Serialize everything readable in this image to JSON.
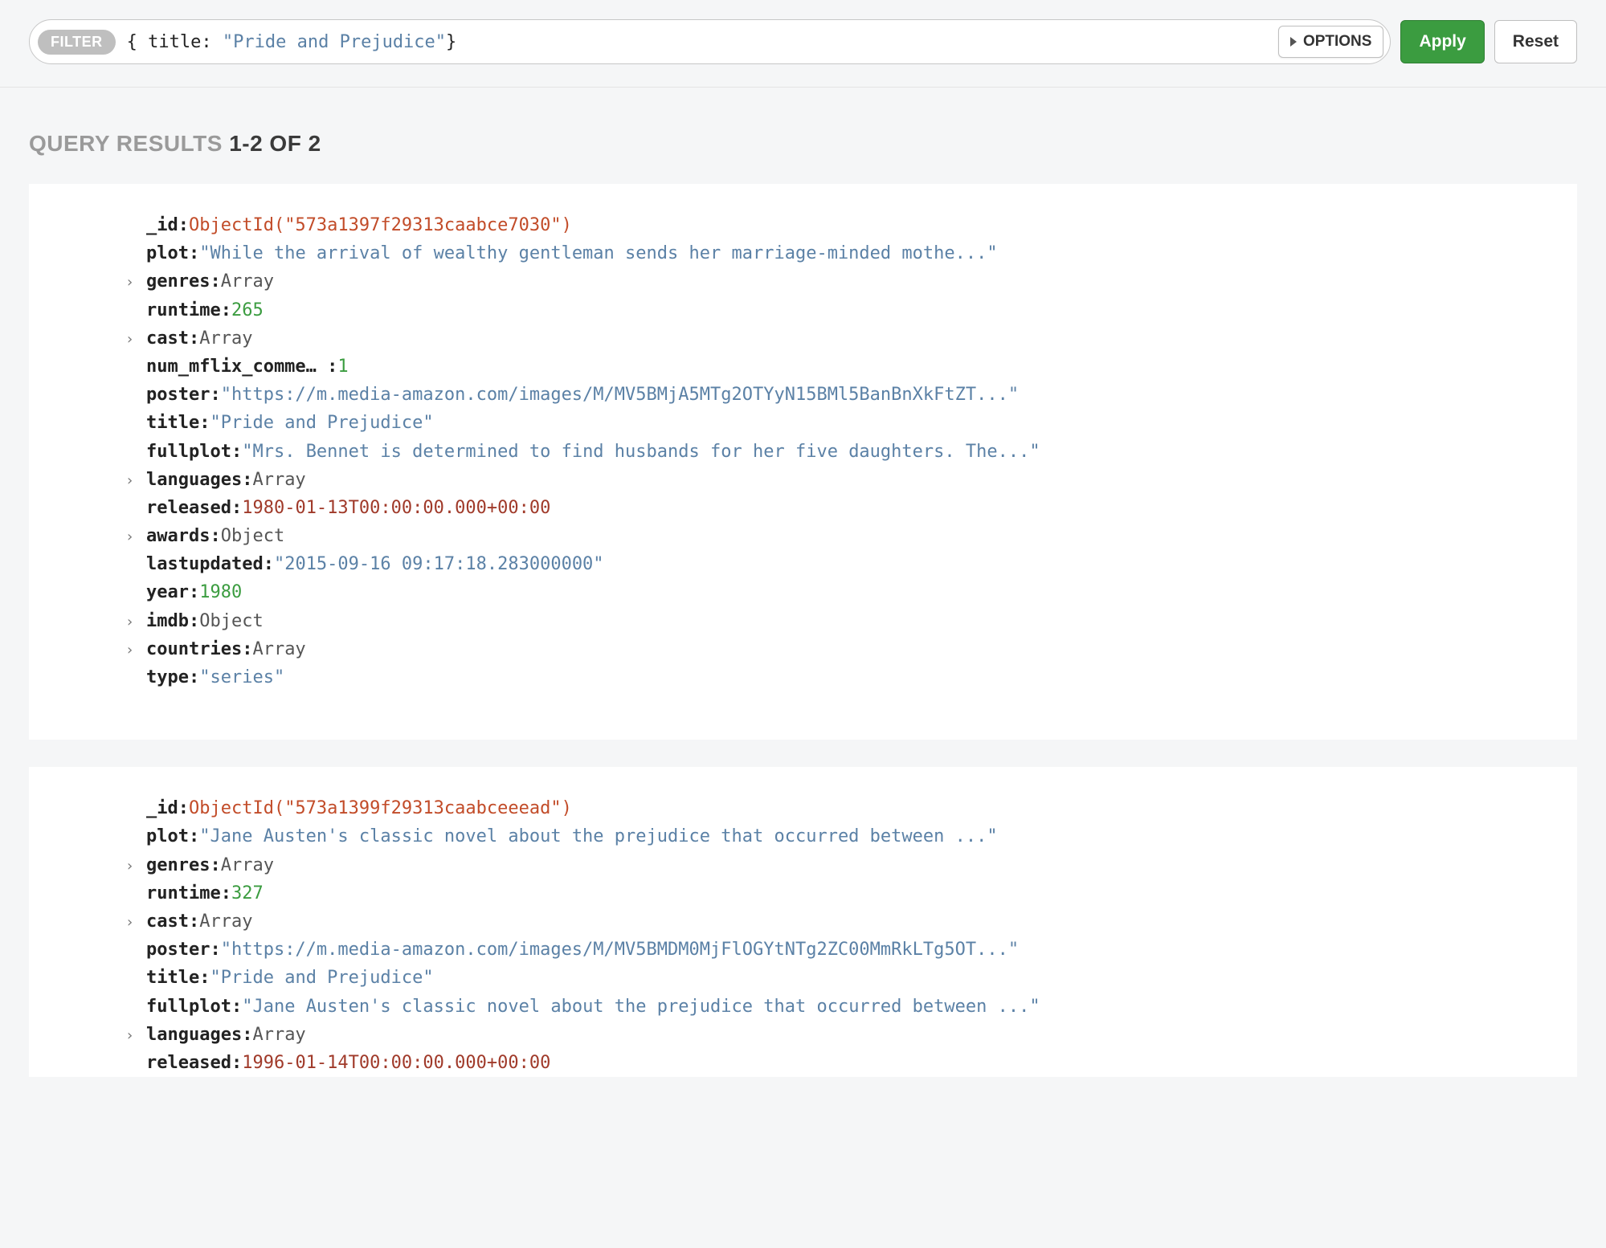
{
  "filter": {
    "pill_label": "FILTER",
    "query_prefix": "{ ",
    "query_key": "title:",
    "query_space": " ",
    "query_value": "\"Pride and Prejudice\"",
    "query_suffix": "}",
    "options_label": "OPTIONS",
    "apply_label": "Apply",
    "reset_label": "Reset"
  },
  "results_header": {
    "label": "QUERY RESULTS",
    "range": "1-2 OF 2"
  },
  "documents": [
    {
      "fields": [
        {
          "key": "_id:",
          "value": "ObjectId(\"573a1397f29313caabce7030\")",
          "vclass": "v-oid",
          "expandable": false
        },
        {
          "key": "plot:",
          "value": "\"While the arrival of wealthy gentleman sends her marriage-minded mothe...\"",
          "vclass": "v-str",
          "expandable": false
        },
        {
          "key": "genres:",
          "value": "Array",
          "vclass": "v-type",
          "expandable": true
        },
        {
          "key": "runtime:",
          "value": "265",
          "vclass": "v-num",
          "expandable": false
        },
        {
          "key": "cast:",
          "value": "Array",
          "vclass": "v-type",
          "expandable": true
        },
        {
          "key": "num_mflix_comme… :",
          "value": "1",
          "vclass": "v-num",
          "expandable": false
        },
        {
          "key": "poster:",
          "value": "\"https://m.media-amazon.com/images/M/MV5BMjA5MTg2OTYyN15BMl5BanBnXkFtZT...\"",
          "vclass": "v-str",
          "expandable": false
        },
        {
          "key": "title:",
          "value": "\"Pride and Prejudice\"",
          "vclass": "v-str",
          "expandable": false
        },
        {
          "key": "fullplot:",
          "value": "\"Mrs. Bennet is determined to find husbands for her five daughters. The...\"",
          "vclass": "v-str",
          "expandable": false
        },
        {
          "key": "languages:",
          "value": "Array",
          "vclass": "v-type",
          "expandable": true
        },
        {
          "key": "released:",
          "value": "1980-01-13T00:00:00.000+00:00",
          "vclass": "v-date",
          "expandable": false
        },
        {
          "key": "awards:",
          "value": "Object",
          "vclass": "v-type",
          "expandable": true
        },
        {
          "key": "lastupdated:",
          "value": "\"2015-09-16 09:17:18.283000000\"",
          "vclass": "v-str",
          "expandable": false
        },
        {
          "key": "year:",
          "value": "1980",
          "vclass": "v-num",
          "expandable": false
        },
        {
          "key": "imdb:",
          "value": "Object",
          "vclass": "v-type",
          "expandable": true
        },
        {
          "key": "countries:",
          "value": "Array",
          "vclass": "v-type",
          "expandable": true
        },
        {
          "key": "type:",
          "value": "\"series\"",
          "vclass": "v-str",
          "expandable": false
        }
      ]
    },
    {
      "fields": [
        {
          "key": "_id:",
          "value": "ObjectId(\"573a1399f29313caabceeead\")",
          "vclass": "v-oid",
          "expandable": false
        },
        {
          "key": "plot:",
          "value": "\"Jane Austen's classic novel about the prejudice that occurred between ...\"",
          "vclass": "v-str",
          "expandable": false
        },
        {
          "key": "genres:",
          "value": "Array",
          "vclass": "v-type",
          "expandable": true
        },
        {
          "key": "runtime:",
          "value": "327",
          "vclass": "v-num",
          "expandable": false
        },
        {
          "key": "cast:",
          "value": "Array",
          "vclass": "v-type",
          "expandable": true
        },
        {
          "key": "poster:",
          "value": "\"https://m.media-amazon.com/images/M/MV5BMDM0MjFlOGYtNTg2ZC00MmRkLTg5OT...\"",
          "vclass": "v-str",
          "expandable": false
        },
        {
          "key": "title:",
          "value": "\"Pride and Prejudice\"",
          "vclass": "v-str",
          "expandable": false
        },
        {
          "key": "fullplot:",
          "value": "\"Jane Austen's classic novel about the prejudice that occurred between ...\"",
          "vclass": "v-str",
          "expandable": false
        },
        {
          "key": "languages:",
          "value": "Array",
          "vclass": "v-type",
          "expandable": true
        },
        {
          "key": "released:",
          "value": "1996-01-14T00:00:00.000+00:00",
          "vclass": "v-date",
          "expandable": false
        }
      ]
    }
  ]
}
